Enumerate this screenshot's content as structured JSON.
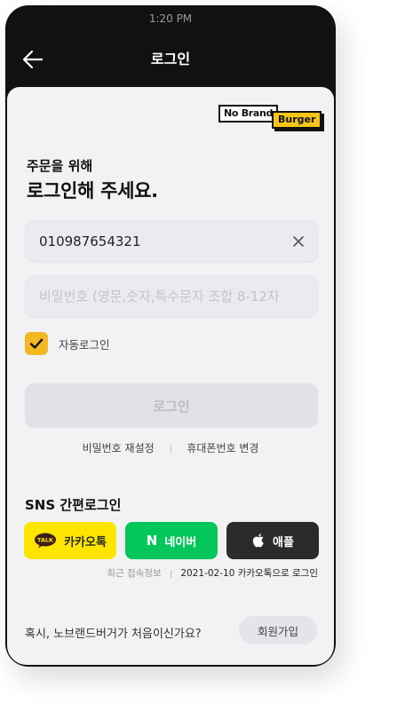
{
  "status_bar": {
    "time": "1:20 PM"
  },
  "nav": {
    "title": "로그인"
  },
  "logo": {
    "part1": "No Brand",
    "part2": "Burger"
  },
  "greeting": {
    "sub": "주문을 위해",
    "main": "로그인해 주세요."
  },
  "phone_field": {
    "value": "010987654321"
  },
  "password_field": {
    "placeholder": "비밀번호 (영문,숫자,특수문자 조합 8-12자)"
  },
  "auto_login": {
    "label": "자동로그인",
    "checked": true
  },
  "login_button": {
    "label": "로그인"
  },
  "links": {
    "reset_password": "비밀번호 재설정",
    "change_phone": "휴대폰번호 변경"
  },
  "sns": {
    "title": "SNS 간편로그인",
    "kakao": {
      "label": "카카오톡",
      "icon_text": "TALK"
    },
    "naver": {
      "label": "네이버",
      "icon_text": "N"
    },
    "apple": {
      "label": "애플"
    }
  },
  "recent": {
    "label": "최근 접속정보",
    "value": "2021-02-10 카카오톡으로 로그인"
  },
  "signup": {
    "prompt": "혹시, 노브랜드버거가 처음이신가요?",
    "button": "회원가입"
  },
  "colors": {
    "accent": "#f2b820",
    "kakao": "#fee500",
    "naver": "#03c75a",
    "apple": "#2b2b2b"
  }
}
